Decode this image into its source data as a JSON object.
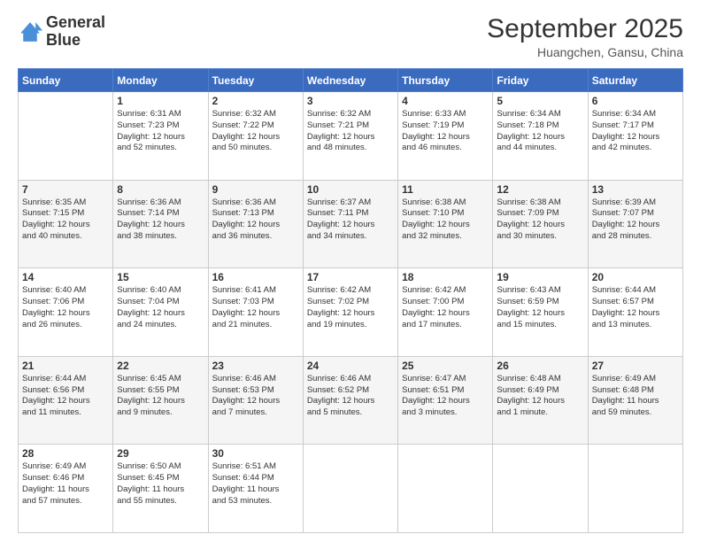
{
  "logo": {
    "line1": "General",
    "line2": "Blue"
  },
  "title": "September 2025",
  "location": "Huangchen, Gansu, China",
  "days_of_week": [
    "Sunday",
    "Monday",
    "Tuesday",
    "Wednesday",
    "Thursday",
    "Friday",
    "Saturday"
  ],
  "weeks": [
    [
      {
        "day": "",
        "info": ""
      },
      {
        "day": "1",
        "info": "Sunrise: 6:31 AM\nSunset: 7:23 PM\nDaylight: 12 hours\nand 52 minutes."
      },
      {
        "day": "2",
        "info": "Sunrise: 6:32 AM\nSunset: 7:22 PM\nDaylight: 12 hours\nand 50 minutes."
      },
      {
        "day": "3",
        "info": "Sunrise: 6:32 AM\nSunset: 7:21 PM\nDaylight: 12 hours\nand 48 minutes."
      },
      {
        "day": "4",
        "info": "Sunrise: 6:33 AM\nSunset: 7:19 PM\nDaylight: 12 hours\nand 46 minutes."
      },
      {
        "day": "5",
        "info": "Sunrise: 6:34 AM\nSunset: 7:18 PM\nDaylight: 12 hours\nand 44 minutes."
      },
      {
        "day": "6",
        "info": "Sunrise: 6:34 AM\nSunset: 7:17 PM\nDaylight: 12 hours\nand 42 minutes."
      }
    ],
    [
      {
        "day": "7",
        "info": "Sunrise: 6:35 AM\nSunset: 7:15 PM\nDaylight: 12 hours\nand 40 minutes."
      },
      {
        "day": "8",
        "info": "Sunrise: 6:36 AM\nSunset: 7:14 PM\nDaylight: 12 hours\nand 38 minutes."
      },
      {
        "day": "9",
        "info": "Sunrise: 6:36 AM\nSunset: 7:13 PM\nDaylight: 12 hours\nand 36 minutes."
      },
      {
        "day": "10",
        "info": "Sunrise: 6:37 AM\nSunset: 7:11 PM\nDaylight: 12 hours\nand 34 minutes."
      },
      {
        "day": "11",
        "info": "Sunrise: 6:38 AM\nSunset: 7:10 PM\nDaylight: 12 hours\nand 32 minutes."
      },
      {
        "day": "12",
        "info": "Sunrise: 6:38 AM\nSunset: 7:09 PM\nDaylight: 12 hours\nand 30 minutes."
      },
      {
        "day": "13",
        "info": "Sunrise: 6:39 AM\nSunset: 7:07 PM\nDaylight: 12 hours\nand 28 minutes."
      }
    ],
    [
      {
        "day": "14",
        "info": "Sunrise: 6:40 AM\nSunset: 7:06 PM\nDaylight: 12 hours\nand 26 minutes."
      },
      {
        "day": "15",
        "info": "Sunrise: 6:40 AM\nSunset: 7:04 PM\nDaylight: 12 hours\nand 24 minutes."
      },
      {
        "day": "16",
        "info": "Sunrise: 6:41 AM\nSunset: 7:03 PM\nDaylight: 12 hours\nand 21 minutes."
      },
      {
        "day": "17",
        "info": "Sunrise: 6:42 AM\nSunset: 7:02 PM\nDaylight: 12 hours\nand 19 minutes."
      },
      {
        "day": "18",
        "info": "Sunrise: 6:42 AM\nSunset: 7:00 PM\nDaylight: 12 hours\nand 17 minutes."
      },
      {
        "day": "19",
        "info": "Sunrise: 6:43 AM\nSunset: 6:59 PM\nDaylight: 12 hours\nand 15 minutes."
      },
      {
        "day": "20",
        "info": "Sunrise: 6:44 AM\nSunset: 6:57 PM\nDaylight: 12 hours\nand 13 minutes."
      }
    ],
    [
      {
        "day": "21",
        "info": "Sunrise: 6:44 AM\nSunset: 6:56 PM\nDaylight: 12 hours\nand 11 minutes."
      },
      {
        "day": "22",
        "info": "Sunrise: 6:45 AM\nSunset: 6:55 PM\nDaylight: 12 hours\nand 9 minutes."
      },
      {
        "day": "23",
        "info": "Sunrise: 6:46 AM\nSunset: 6:53 PM\nDaylight: 12 hours\nand 7 minutes."
      },
      {
        "day": "24",
        "info": "Sunrise: 6:46 AM\nSunset: 6:52 PM\nDaylight: 12 hours\nand 5 minutes."
      },
      {
        "day": "25",
        "info": "Sunrise: 6:47 AM\nSunset: 6:51 PM\nDaylight: 12 hours\nand 3 minutes."
      },
      {
        "day": "26",
        "info": "Sunrise: 6:48 AM\nSunset: 6:49 PM\nDaylight: 12 hours\nand 1 minute."
      },
      {
        "day": "27",
        "info": "Sunrise: 6:49 AM\nSunset: 6:48 PM\nDaylight: 11 hours\nand 59 minutes."
      }
    ],
    [
      {
        "day": "28",
        "info": "Sunrise: 6:49 AM\nSunset: 6:46 PM\nDaylight: 11 hours\nand 57 minutes."
      },
      {
        "day": "29",
        "info": "Sunrise: 6:50 AM\nSunset: 6:45 PM\nDaylight: 11 hours\nand 55 minutes."
      },
      {
        "day": "30",
        "info": "Sunrise: 6:51 AM\nSunset: 6:44 PM\nDaylight: 11 hours\nand 53 minutes."
      },
      {
        "day": "",
        "info": ""
      },
      {
        "day": "",
        "info": ""
      },
      {
        "day": "",
        "info": ""
      },
      {
        "day": "",
        "info": ""
      }
    ]
  ]
}
